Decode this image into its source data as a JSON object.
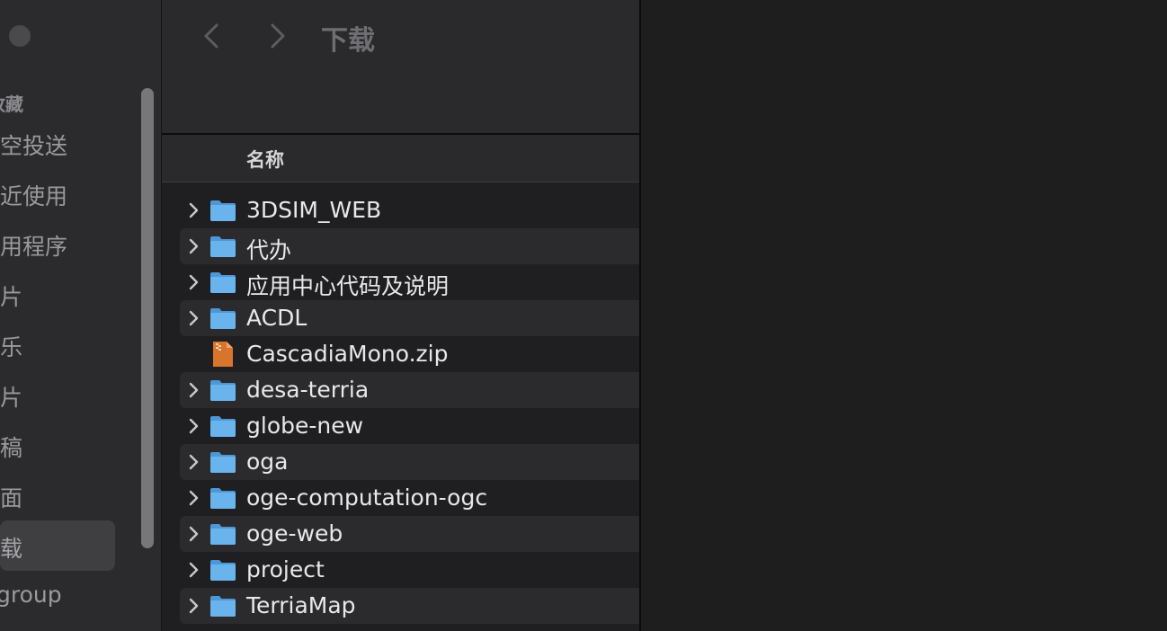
{
  "sidebar": {
    "section_title": "收藏",
    "items": [
      {
        "label": "隔空投送",
        "selected": false
      },
      {
        "label": "最近使用",
        "selected": false
      },
      {
        "label": "应用程序",
        "selected": false
      },
      {
        "label": "影片",
        "selected": false
      },
      {
        "label": "音乐",
        "selected": false
      },
      {
        "label": "图片",
        "selected": false
      },
      {
        "label": "文稿",
        "selected": false
      },
      {
        "label": "桌面",
        "selected": false
      },
      {
        "label": "下载",
        "selected": true
      },
      {
        "label": "group",
        "selected": false
      }
    ]
  },
  "toolbar": {
    "title": "下载"
  },
  "list": {
    "column_name": "名称",
    "rows": [
      {
        "name": "3DSIM_WEB",
        "type": "folder"
      },
      {
        "name": "代办",
        "type": "folder"
      },
      {
        "name": "应用中心代码及说明",
        "type": "folder"
      },
      {
        "name": "ACDL",
        "type": "folder"
      },
      {
        "name": "CascadiaMono.zip",
        "type": "zip"
      },
      {
        "name": "desa-terria",
        "type": "folder"
      },
      {
        "name": "globe-new",
        "type": "folder"
      },
      {
        "name": "oga",
        "type": "folder"
      },
      {
        "name": "oge-computation-ogc",
        "type": "folder"
      },
      {
        "name": "oge-web",
        "type": "folder"
      },
      {
        "name": "project",
        "type": "folder"
      },
      {
        "name": "TerriaMap",
        "type": "folder"
      }
    ]
  },
  "colors": {
    "folder_blue": "#6ab4ee",
    "zip_orange": "#d8752d"
  }
}
